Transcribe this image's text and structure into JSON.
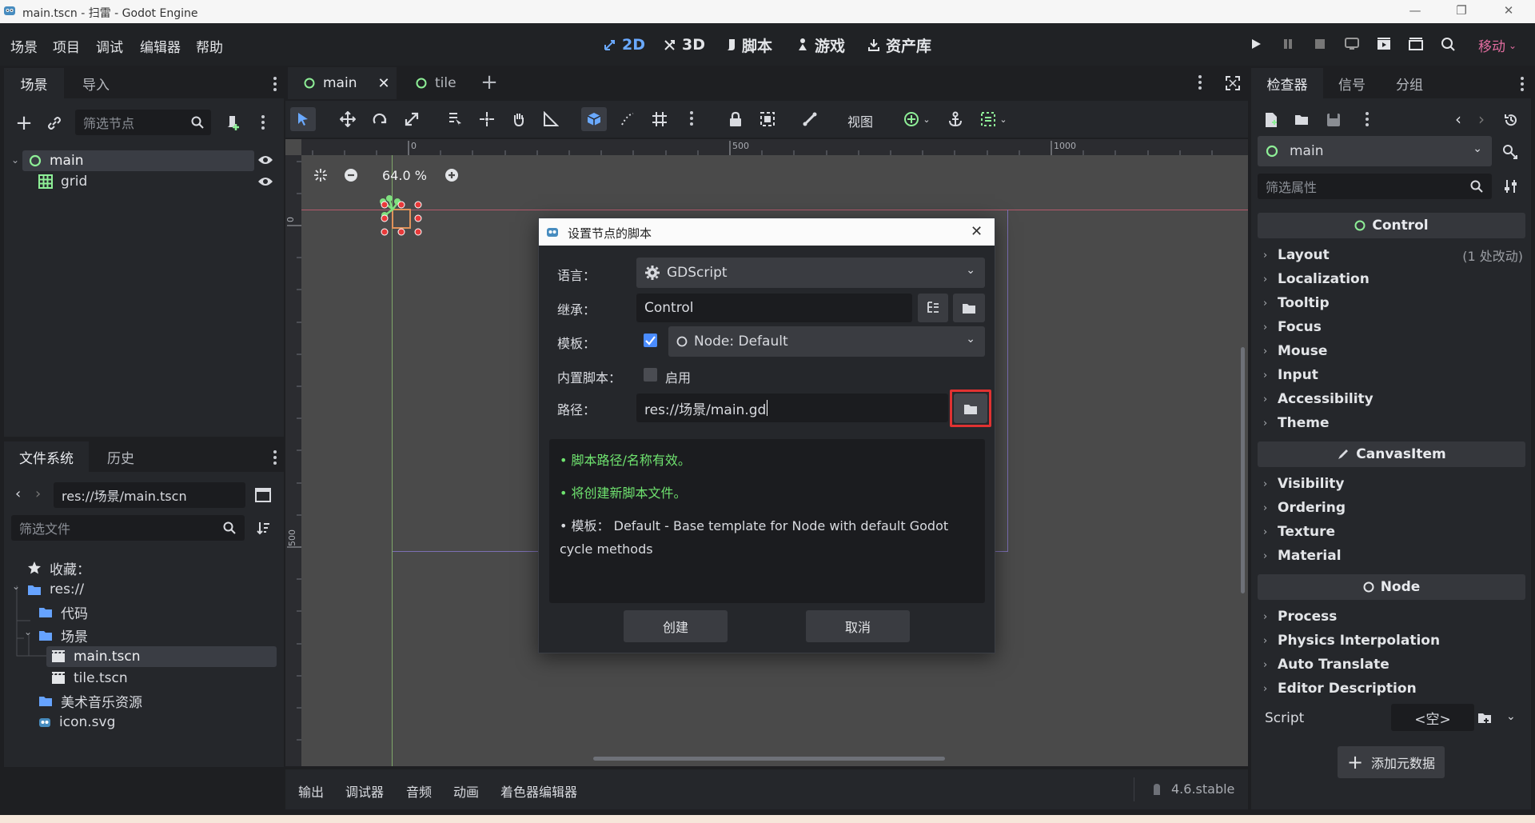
{
  "window": {
    "title": "main.tscn - 扫雷 - Godot Engine"
  },
  "menu": [
    "场景",
    "项目",
    "调试",
    "编辑器",
    "帮助"
  ],
  "workspaces": [
    {
      "label": "2D",
      "icon": "2d-icon"
    },
    {
      "label": "3D",
      "icon": "3d-icon"
    },
    {
      "label": "脚本",
      "icon": "script-icon"
    },
    {
      "label": "游戏",
      "icon": "game-icon"
    },
    {
      "label": "资产库",
      "icon": "assetlib-icon"
    }
  ],
  "renderer": "移动",
  "scene_dock": {
    "tabs": [
      "场景",
      "导入"
    ],
    "filter_placeholder": "筛选节点",
    "tree": [
      {
        "name": "main",
        "icon": "control-node-icon",
        "selected": true
      },
      {
        "name": "grid",
        "icon": "gridcontainer-icon",
        "selected": false
      }
    ]
  },
  "filesystem_dock": {
    "tabs": [
      "文件系统",
      "历史"
    ],
    "path": "res://场景/main.tscn",
    "filter_placeholder": "筛选文件",
    "items": [
      {
        "label": "收藏：",
        "icon": "star-icon"
      },
      {
        "label": "res://",
        "icon": "folder-icon"
      },
      {
        "label": "代码",
        "icon": "folder-icon"
      },
      {
        "label": "场景",
        "icon": "folder-icon"
      },
      {
        "label": "main.tscn",
        "icon": "scene-file-icon",
        "selected": true
      },
      {
        "label": "tile.tscn",
        "icon": "scene-file-icon"
      },
      {
        "label": "美术音乐资源",
        "icon": "folder-icon"
      },
      {
        "label": "icon.svg",
        "icon": "godot-icon"
      }
    ]
  },
  "editor_tabs": [
    "main",
    "tile"
  ],
  "toolbar": {
    "view_label": "视图"
  },
  "viewport": {
    "zoom": "64.0 %",
    "ruler_top": [
      "0",
      "500",
      "1000"
    ],
    "ruler_left": [
      "0",
      "500"
    ]
  },
  "dialog": {
    "title": "设置节点的脚本",
    "language_label": "语言：",
    "language_value": "GDScript",
    "inherits_label": "继承：",
    "inherits_value": "Control",
    "template_label": "模板：",
    "template_checked": true,
    "template_value": "Node: Default",
    "builtin_label": "内置脚本：",
    "builtin_toggle_label": "启用",
    "builtin_checked": false,
    "path_label": "路径：",
    "path_value": "res://场景/main.gd",
    "messages": [
      {
        "text": "脚本路径/名称有效。",
        "color": "#6fe36f"
      },
      {
        "text": "将创建新脚本文件。",
        "color": "#6fe36f"
      },
      {
        "text": "模板： Default - Base template for Node with default Godot cycle methods",
        "color": "#d9dbe0"
      }
    ],
    "create_label": "创建",
    "cancel_label": "取消",
    "highlight_color": "#e03232"
  },
  "inspector": {
    "tabs": [
      "检查器",
      "信号",
      "分组"
    ],
    "node_name": "main",
    "filter_placeholder": "筛选属性",
    "sections": [
      {
        "header": "Control",
        "icon": "control-node-icon",
        "props": [
          "Layout",
          "Localization",
          "Tooltip",
          "Focus",
          "Mouse",
          "Input",
          "Accessibility",
          "Theme"
        ],
        "layout_note": "(1 处改动)"
      },
      {
        "header": "CanvasItem",
        "icon": "canvasitem-icon",
        "props": [
          "Visibility",
          "Ordering",
          "Texture",
          "Material"
        ]
      },
      {
        "header": "Node",
        "icon": "node-icon",
        "props": [
          "Process",
          "Physics Interpolation",
          "Auto Translate",
          "Editor Description"
        ]
      }
    ],
    "script_label": "Script",
    "script_value": "<空>",
    "add_metadata_label": "添加元数据"
  },
  "bottom_panel": {
    "tabs": [
      "输出",
      "调试器",
      "音频",
      "动画",
      "着色器编辑器"
    ],
    "version": "4.6.stable"
  },
  "colors": {
    "accent": "#6aa9ff",
    "node_green": "#8eef97",
    "bg": "#1e1f22",
    "panel": "#25272b"
  }
}
